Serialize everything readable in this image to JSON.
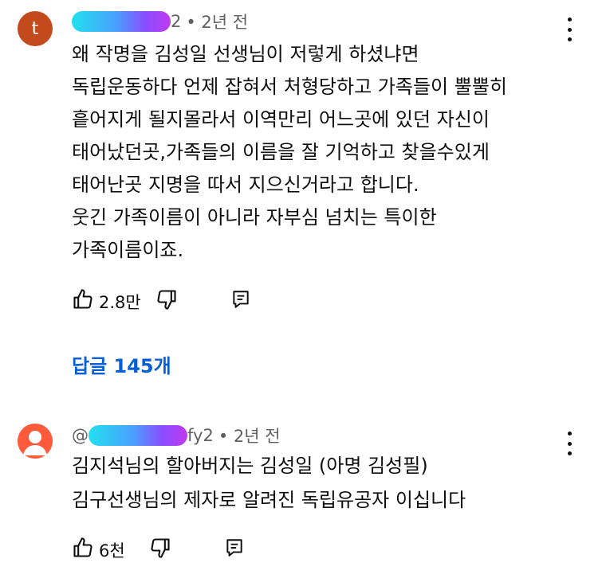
{
  "comments": [
    {
      "avatar_letter": "t",
      "handle_suffix": "2",
      "time": "• 2년 전",
      "lines": [
        "왜 작명을 김성일 선생님이 저렇게 하셨냐면",
        "독립운동하다 언제 잡혀서 처형당하고 가족들이 뿔뿔히",
        "흩어지게 될지몰라서 이역만리 어느곳에 있던 자신이",
        "태어났던곳,가족들의 이름을 잘 기억하고 찾을수있게",
        "태어난곳 지명을 따서 지으신거라고 합니다.",
        "웃긴 가족이름이 아니라 자부심 넘치는 특이한",
        "가족이름이죠."
      ],
      "likes": "2.8만",
      "reply_count": "답글 145개"
    },
    {
      "handle_prefix": "@",
      "handle_suffix": "fy2",
      "time": "• 2년 전",
      "lines": [
        "김지석님의  할아버지는 김성일 (아명  김성필)",
        "김구선생님의 제자로  알려진  독립유공자 이십니다"
      ],
      "likes": "6천"
    }
  ],
  "icons": {
    "like": "thumbs-up-icon",
    "dislike": "thumbs-down-icon",
    "reply": "reply-comment-icon",
    "menu": "more-vert-icon"
  },
  "colors": {
    "link_blue": "#065fd4",
    "avatar_t": "#c24a1c",
    "avatar_person": "#ff5a3c"
  }
}
